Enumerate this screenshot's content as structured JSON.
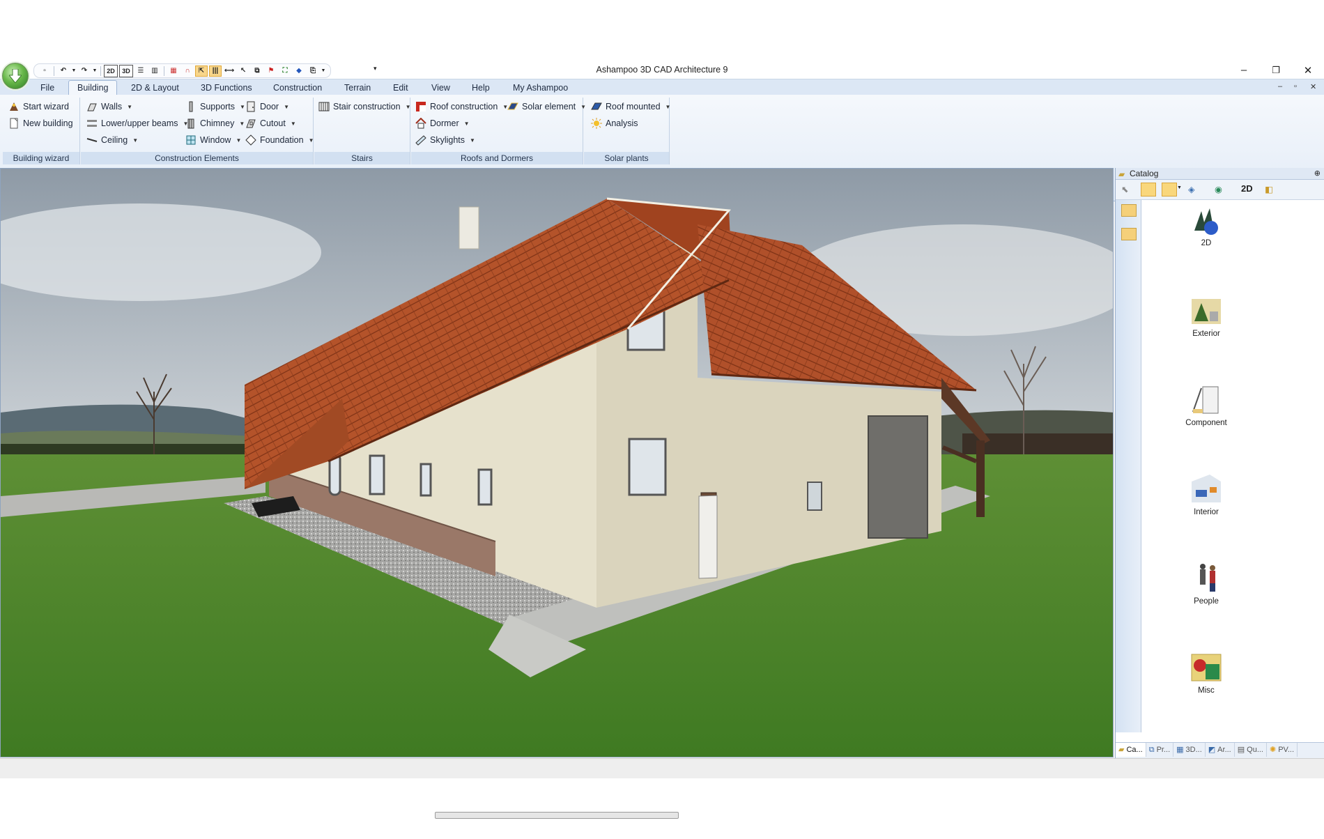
{
  "window": {
    "title": "Ashampoo 3D CAD Architecture 9",
    "minimize": "–",
    "maximize": "❐",
    "close": "✕"
  },
  "qat": {
    "btn_2d": "2D",
    "btn_3d": "3D"
  },
  "tabs": [
    {
      "label": "File"
    },
    {
      "label": "Building",
      "active": true
    },
    {
      "label": "2D & Layout"
    },
    {
      "label": "3D Functions"
    },
    {
      "label": "Construction"
    },
    {
      "label": "Terrain"
    },
    {
      "label": "Edit"
    },
    {
      "label": "View"
    },
    {
      "label": "Help"
    },
    {
      "label": "My Ashampoo"
    }
  ],
  "ribbon": {
    "building_wizard": {
      "label": "Building wizard",
      "start_wizard": "Start wizard",
      "new_building": "New building"
    },
    "construction_elements": {
      "label": "Construction Elements",
      "walls": "Walls",
      "lower_upper_beams": "Lower/upper beams",
      "ceiling": "Ceiling",
      "supports": "Supports",
      "chimney": "Chimney",
      "window": "Window",
      "door": "Door",
      "cutout": "Cutout",
      "foundation": "Foundation"
    },
    "stairs": {
      "label": "Stairs",
      "stair_construction": "Stair construction"
    },
    "roofs_and_dormers": {
      "label": "Roofs and Dormers",
      "roof_construction": "Roof construction",
      "dormer": "Dormer",
      "skylights": "Skylights",
      "solar_element": "Solar element"
    },
    "solar_plants": {
      "label": "Solar plants",
      "roof_mounted": "Roof mounted",
      "analysis": "Analysis"
    }
  },
  "catalog": {
    "title": "Catalog",
    "toolbar_2d": "2D",
    "items": [
      {
        "label": "2D"
      },
      {
        "label": "Exterior"
      },
      {
        "label": "Component"
      },
      {
        "label": "Interior"
      },
      {
        "label": "People"
      },
      {
        "label": "Misc"
      }
    ],
    "bottom_tabs": [
      {
        "label": "Ca..."
      },
      {
        "label": "Pr..."
      },
      {
        "label": "3D..."
      },
      {
        "label": "Ar..."
      },
      {
        "label": "Qu..."
      },
      {
        "label": "PV..."
      }
    ]
  },
  "colors": {
    "ribbon_group_label_bg": "#d2e0f1",
    "roof": "#b4532a",
    "wall": "#e6e1cc",
    "grass": "#4f8a2c"
  }
}
